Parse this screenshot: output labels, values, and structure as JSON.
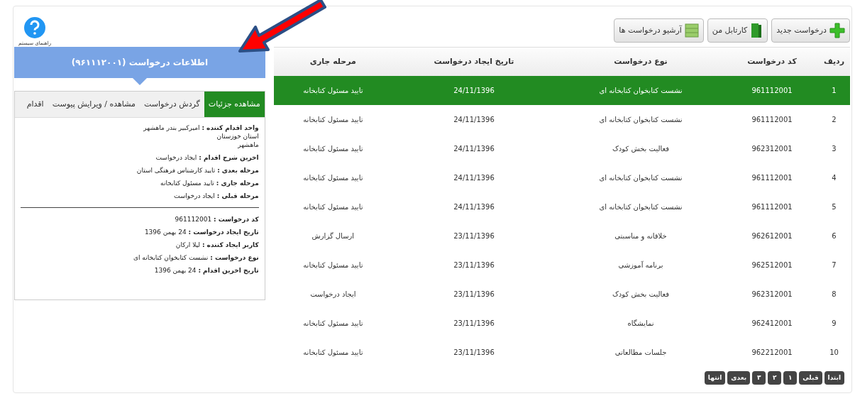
{
  "help": {
    "label": "راهنمای سیستم"
  },
  "toolbar": [
    {
      "kind": "new",
      "label": "درخواست جدید"
    },
    {
      "kind": "folder",
      "label": "کارتابل من"
    },
    {
      "kind": "archive",
      "label": "آرشیو درخواست ها"
    }
  ],
  "info_panel": {
    "title": "اطلاعات درخواست (۹۶۱۱۱۲۰۰۱)",
    "tabs": [
      {
        "label": "مشاهده جزئیات",
        "selected": true
      },
      {
        "label": "گردش درخواست",
        "selected": false
      },
      {
        "label": "مشاهده / ویرایش پیوست",
        "selected": false
      },
      {
        "label": "اقدام",
        "selected": false
      }
    ],
    "details": [
      {
        "label": "واحد اقدام کننده :",
        "value": "امیرکبیر بندر ماهشهر",
        "extra": [
          "استان خوزستان",
          "ماهشهر"
        ]
      },
      {
        "label": "اخرین شرح اقدام :",
        "value": "ایجاد درخواست"
      },
      {
        "label": "مرحله بعدی :",
        "value": "تایید کارشناس فرهنگی استان"
      },
      {
        "label": "مرحله جاری :",
        "value": "تایید مسئول کتابخانه"
      },
      {
        "label": "مرحله قبلی :",
        "value": "ایجاد درخواست"
      }
    ],
    "summary": [
      {
        "label": "کد درخواست :",
        "value": "961112001"
      },
      {
        "label": "تاریخ ایجاد درخواست :",
        "value": "24 بهمن 1396"
      },
      {
        "label": "کاربر ایجاد کننده :",
        "value": "لیلا ارکان"
      },
      {
        "label": "نوع درخواست :",
        "value": "نشست کتابخوان کتابخانه ای"
      },
      {
        "label": "تاریخ اخرین اقدام :",
        "value": "24 بهمن 1396"
      }
    ]
  },
  "table": {
    "columns": [
      "ردیف",
      "کد درخواست",
      "نوع درخواست",
      "تاریخ ایجاد درخواست",
      "مرحله جاری"
    ],
    "rows": [
      {
        "selected": true,
        "cells": [
          "1",
          "961112001",
          "نشست کتابخوان کتابخانه ای",
          "24/11/1396",
          "تایید مسئول کتابخانه"
        ]
      },
      {
        "selected": false,
        "cells": [
          "2",
          "961112001",
          "نشست کتابخوان کتابخانه ای",
          "24/11/1396",
          "تایید مسئول کتابخانه"
        ]
      },
      {
        "selected": false,
        "cells": [
          "3",
          "962312001",
          "فعالیت بخش کودک",
          "24/11/1396",
          "تایید مسئول کتابخانه"
        ]
      },
      {
        "selected": false,
        "cells": [
          "4",
          "961112001",
          "نشست کتابخوان کتابخانه ای",
          "24/11/1396",
          "تایید مسئول کتابخانه"
        ]
      },
      {
        "selected": false,
        "cells": [
          "5",
          "961112001",
          "نشست کتابخوان کتابخانه ای",
          "24/11/1396",
          "تایید مسئول کتابخانه"
        ]
      },
      {
        "selected": false,
        "cells": [
          "6",
          "962612001",
          "خلاقانه و مناسبتی",
          "23/11/1396",
          "ارسال گزارش"
        ]
      },
      {
        "selected": false,
        "cells": [
          "7",
          "962512001",
          "برنامه آموزشی",
          "23/11/1396",
          "تایید مسئول کتابخانه"
        ]
      },
      {
        "selected": false,
        "cells": [
          "8",
          "962312001",
          "فعالیت بخش کودک",
          "23/11/1396",
          "ایجاد درخواست"
        ]
      },
      {
        "selected": false,
        "cells": [
          "9",
          "962412001",
          "نمایشگاه",
          "23/11/1396",
          "تایید مسئول کتابخانه"
        ]
      },
      {
        "selected": false,
        "cells": [
          "10",
          "962212001",
          "جلسات مطالعاتی",
          "23/11/1396",
          "تایید مسئول کتابخانه"
        ]
      }
    ]
  },
  "pagination": [
    "ابتدا",
    "قبلی",
    "۱",
    "۲",
    "۳",
    "بعدی",
    "انتها"
  ]
}
